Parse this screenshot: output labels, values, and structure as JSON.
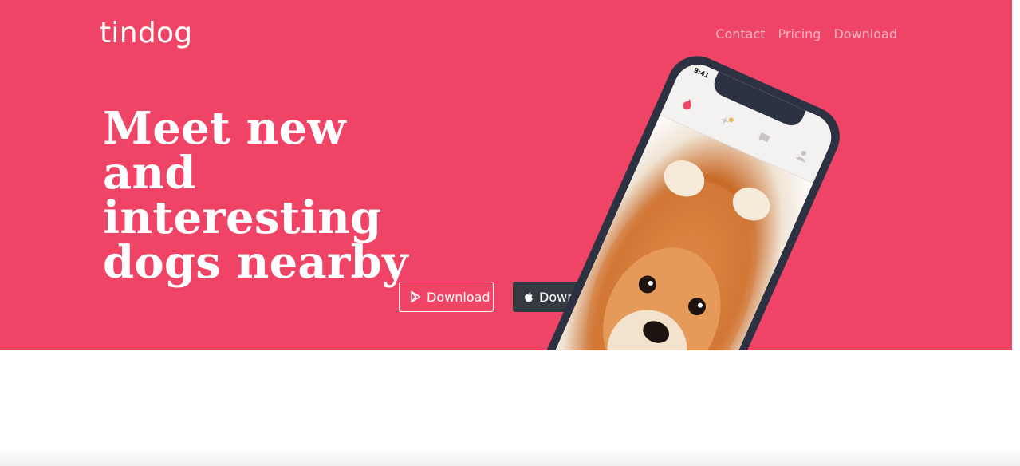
{
  "brand": {
    "name": "tindog"
  },
  "nav": {
    "items": [
      {
        "label": "Contact"
      },
      {
        "label": "Pricing"
      },
      {
        "label": "Download"
      }
    ]
  },
  "hero": {
    "headline": "Meet new and interesting dogs nearby",
    "buttons": {
      "play_label": "Download",
      "apple_label": "Download"
    },
    "phone": {
      "status_time": "9:41"
    }
  },
  "colors": {
    "hero_bg": "#f04466",
    "dark_button": "#343a40",
    "phone_frame": "#2d3242"
  },
  "icons": {
    "play": "google-play-icon",
    "apple": "apple-icon"
  }
}
